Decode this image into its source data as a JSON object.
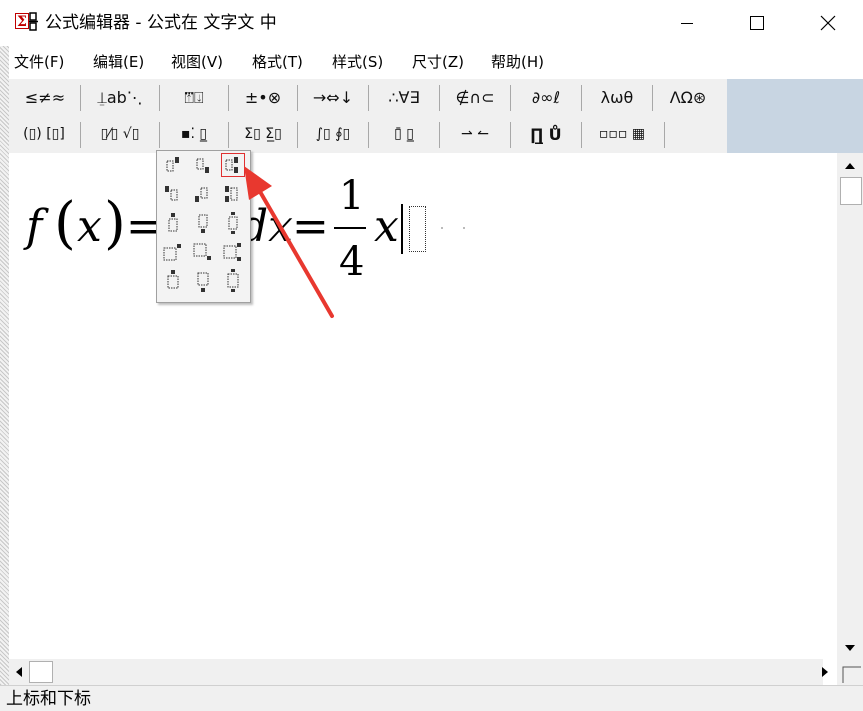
{
  "window": {
    "title": "公式编辑器 - 公式在 文字文 中",
    "app_icon": "equation-editor-icon",
    "controls": [
      "minimize-icon",
      "maximize-icon",
      "close-icon"
    ]
  },
  "menu": [
    {
      "id": "file",
      "label": "文件(F)"
    },
    {
      "id": "edit",
      "label": "编辑(E)"
    },
    {
      "id": "view",
      "label": "视图(V)"
    },
    {
      "id": "format",
      "label": "格式(T)"
    },
    {
      "id": "style",
      "label": "样式(S)"
    },
    {
      "id": "size",
      "label": "尺寸(Z)"
    },
    {
      "id": "help",
      "label": "帮助(H)"
    }
  ],
  "toolbar": {
    "row1": [
      {
        "id": "relations",
        "label": "≤≠≈"
      },
      {
        "id": "spaces",
        "label": "⍊ab⋱"
      },
      {
        "id": "embellishments",
        "label": "⍐⃛⍗"
      },
      {
        "id": "operators",
        "label": "±•⊗"
      },
      {
        "id": "arrows",
        "label": "→⇔↓"
      },
      {
        "id": "logic",
        "label": "∴∀∃"
      },
      {
        "id": "set-theory",
        "label": "∉∩⊂"
      },
      {
        "id": "misc-symbols",
        "label": "∂∞ℓ"
      },
      {
        "id": "greek-lower",
        "label": "λωθ"
      },
      {
        "id": "greek-upper",
        "label": "ΛΩ⊛"
      }
    ],
    "row2": [
      {
        "id": "fences",
        "label": "(▯) [▯]"
      },
      {
        "id": "fractions-radicals",
        "label": "▯⁄▯ √▯"
      },
      {
        "id": "scripts",
        "label": "▪⁚ ▯̲"
      },
      {
        "id": "summations",
        "label": "Σ▯ Σ̲▯"
      },
      {
        "id": "integrals",
        "label": "∫▯ ∮▯"
      },
      {
        "id": "bars",
        "label": "▯̄ ▯̲"
      },
      {
        "id": "labeled-arrows",
        "label": "⇀ ↼"
      },
      {
        "id": "products",
        "label": "∏̲ Ů"
      },
      {
        "id": "matrices",
        "label": "▫▫▫ ▦"
      }
    ]
  },
  "formula": {
    "f": "f",
    "lparen": "(",
    "x1": "x",
    "rparen": ")",
    "eq1": "=",
    "dx": "dx",
    "eq2": "=",
    "numerator": "1",
    "denominator": "4",
    "x2": "x"
  },
  "palette": {
    "name": "subscript-superscript-templates",
    "selected_index": 2,
    "rows": 5,
    "cols": 3
  },
  "status": "上标和下标",
  "colors": {
    "annotation_arrow": "#e8382f",
    "toolbar_bg": "#f0f0f0",
    "toolbar_right_bg": "#c8d5e2"
  }
}
